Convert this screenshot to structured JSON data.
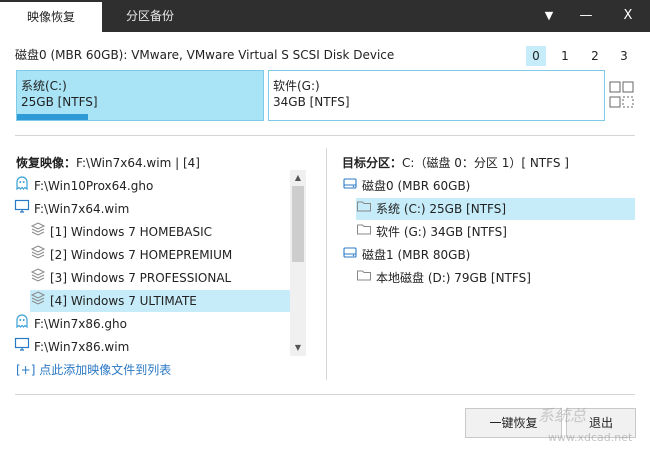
{
  "tabs": [
    {
      "label": "映像恢复",
      "active": true
    },
    {
      "label": "分区备份",
      "active": false
    }
  ],
  "window_controls": {
    "dropdown": "▼",
    "minimize": "—",
    "close": "X"
  },
  "disk": {
    "title": "磁盘0 (MBR 60GB): VMware, VMware Virtual S SCSI Disk Device",
    "numbers": [
      "0",
      "1",
      "2",
      "3"
    ],
    "selected_number": 0,
    "partitions": [
      {
        "name": "系统(C:)",
        "size": "25GB [NTFS]",
        "used_fraction": 0.29
      },
      {
        "name": "软件(G:)",
        "size": "34GB [NTFS]",
        "used_fraction": 0
      }
    ]
  },
  "left": {
    "label": "恢复映像：",
    "value": "F:\\Win7x64.wim | [4]",
    "items": [
      {
        "text": "F:\\Win10Prox64.gho",
        "icon": "ghost-icon",
        "level": 0
      },
      {
        "text": "F:\\Win7x64.wim",
        "icon": "monitor-icon",
        "level": 0
      },
      {
        "text": "[1] Windows 7 HOMEBASIC",
        "icon": "layers-icon",
        "level": 1
      },
      {
        "text": "[2] Windows 7 HOMEPREMIUM",
        "icon": "layers-icon",
        "level": 1
      },
      {
        "text": "[3] Windows 7 PROFESSIONAL",
        "icon": "layers-icon",
        "level": 1
      },
      {
        "text": "[4] Windows 7 ULTIMATE",
        "icon": "layers-icon",
        "level": 1,
        "selected": true
      },
      {
        "text": "F:\\Win7x86.gho",
        "icon": "ghost-icon",
        "level": 0
      },
      {
        "text": "F:\\Win7x86.wim",
        "icon": "monitor-icon",
        "level": 0
      }
    ],
    "add_link": "[+] 点此添加映像文件到列表"
  },
  "right": {
    "label": "目标分区：",
    "value": "C:（磁盘 0：分区 1）[ NTFS ]",
    "items": [
      {
        "text": "磁盘0 (MBR 60GB)",
        "icon": "disk-icon",
        "level": 0
      },
      {
        "text": "系统 (C:) 25GB [NTFS]",
        "icon": "folder-icon",
        "level": 1,
        "selected": true
      },
      {
        "text": "软件 (G:) 34GB [NTFS]",
        "icon": "folder-icon",
        "level": 1
      },
      {
        "text": "磁盘1 (MBR 80GB)",
        "icon": "disk-icon",
        "level": 0
      },
      {
        "text": "本地磁盘 (D:) 79GB [NTFS]",
        "icon": "folder-icon",
        "level": 1
      }
    ]
  },
  "buttons": {
    "restore": "一键恢复",
    "exit": "退出"
  },
  "watermark": {
    "text": "系统总",
    "url": "www.xdcad.net"
  },
  "colors": {
    "titlebar": "#2f2f2f",
    "selection": "#c7ecf9",
    "partition_selected": "#a8e3f6",
    "partition_border": "#7fcbe7",
    "used_bar": "#2e9ad6",
    "link": "#2a79c5"
  }
}
